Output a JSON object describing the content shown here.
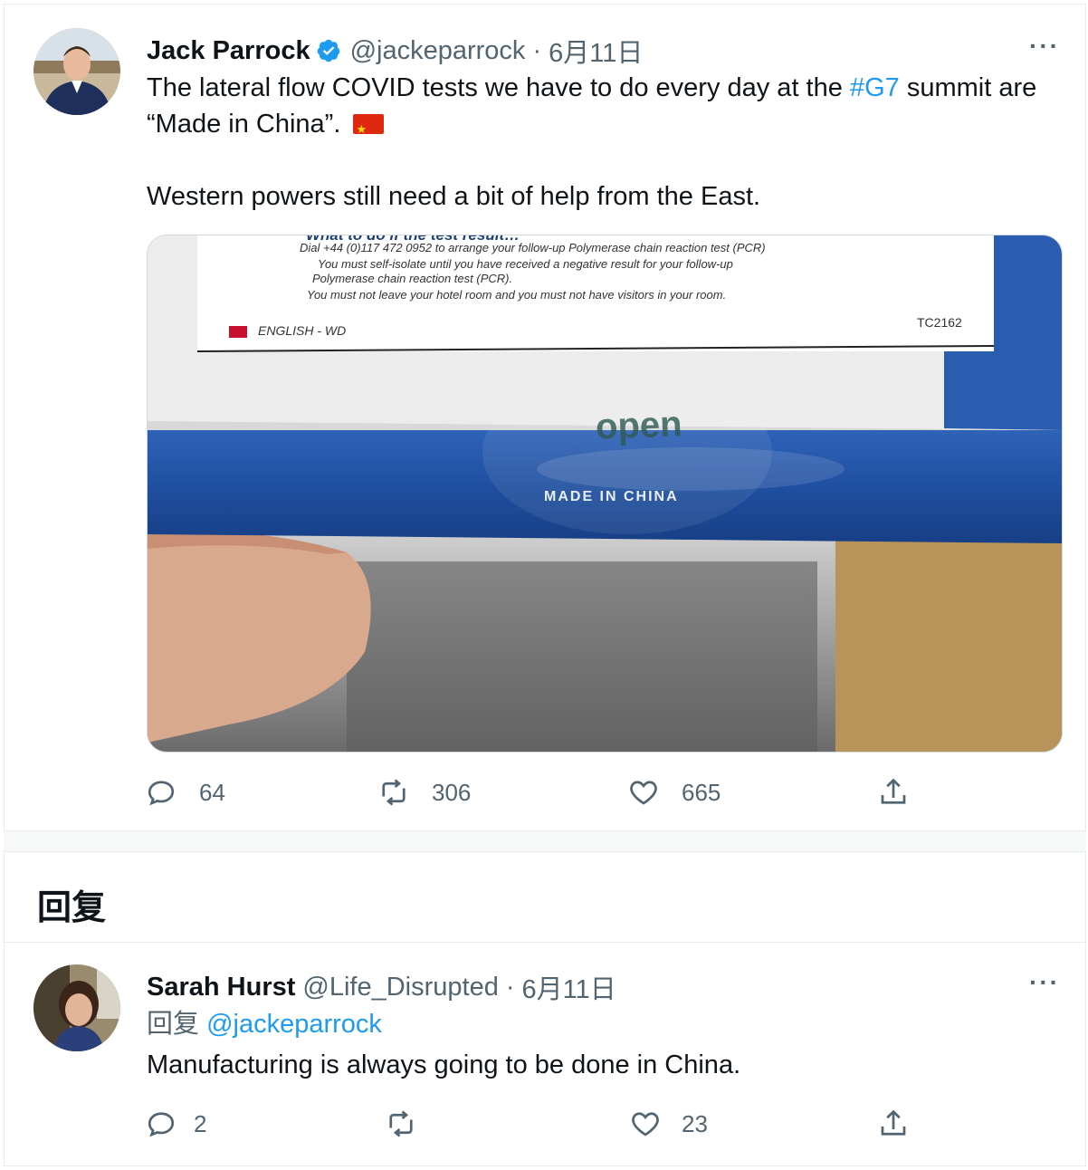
{
  "tweet": {
    "author_name": "Jack Parrock",
    "handle": "@jackeparrock",
    "separator": "·",
    "date": "6月11日",
    "more": "···",
    "text_part1": "The lateral flow COVID tests we have to do every day at the ",
    "hashtag": "#G7",
    "text_part2": " summit are “Made in China”. ",
    "text_para2": "Western powers still need a bit of help from the East.",
    "image": {
      "line1": "What to do if the test result…",
      "line2": "Dial +44 (0)117 472 0952 to arrange your follow-up Polymerase chain reaction test (PCR)",
      "line3": "You must self-isolate until you have received a negative result for your follow-up",
      "line4": "Polymerase chain reaction test (PCR).",
      "line5": "You must not leave your hotel room and you must not have visitors in your room.",
      "language": "ENGLISH - WD",
      "code": "TC2162",
      "sticker": "open",
      "made_in": "MADE IN CHINA"
    },
    "replies": "64",
    "retweets": "306",
    "likes": "665"
  },
  "replies_header": "回复",
  "reply": {
    "author_name": "Sarah Hurst",
    "handle": "@Life_Disrupted",
    "separator": "·",
    "date": "6月11日",
    "more": "···",
    "replying_label": "回复",
    "replying_to": "@jackeparrock",
    "text": "Manufacturing is always going to be done in China.",
    "replies": "2",
    "retweets": "",
    "likes": "23"
  },
  "colors": {
    "link": "#1d9bf0",
    "muted": "#536471",
    "text": "#0f1419",
    "border": "#e6ecf0"
  }
}
